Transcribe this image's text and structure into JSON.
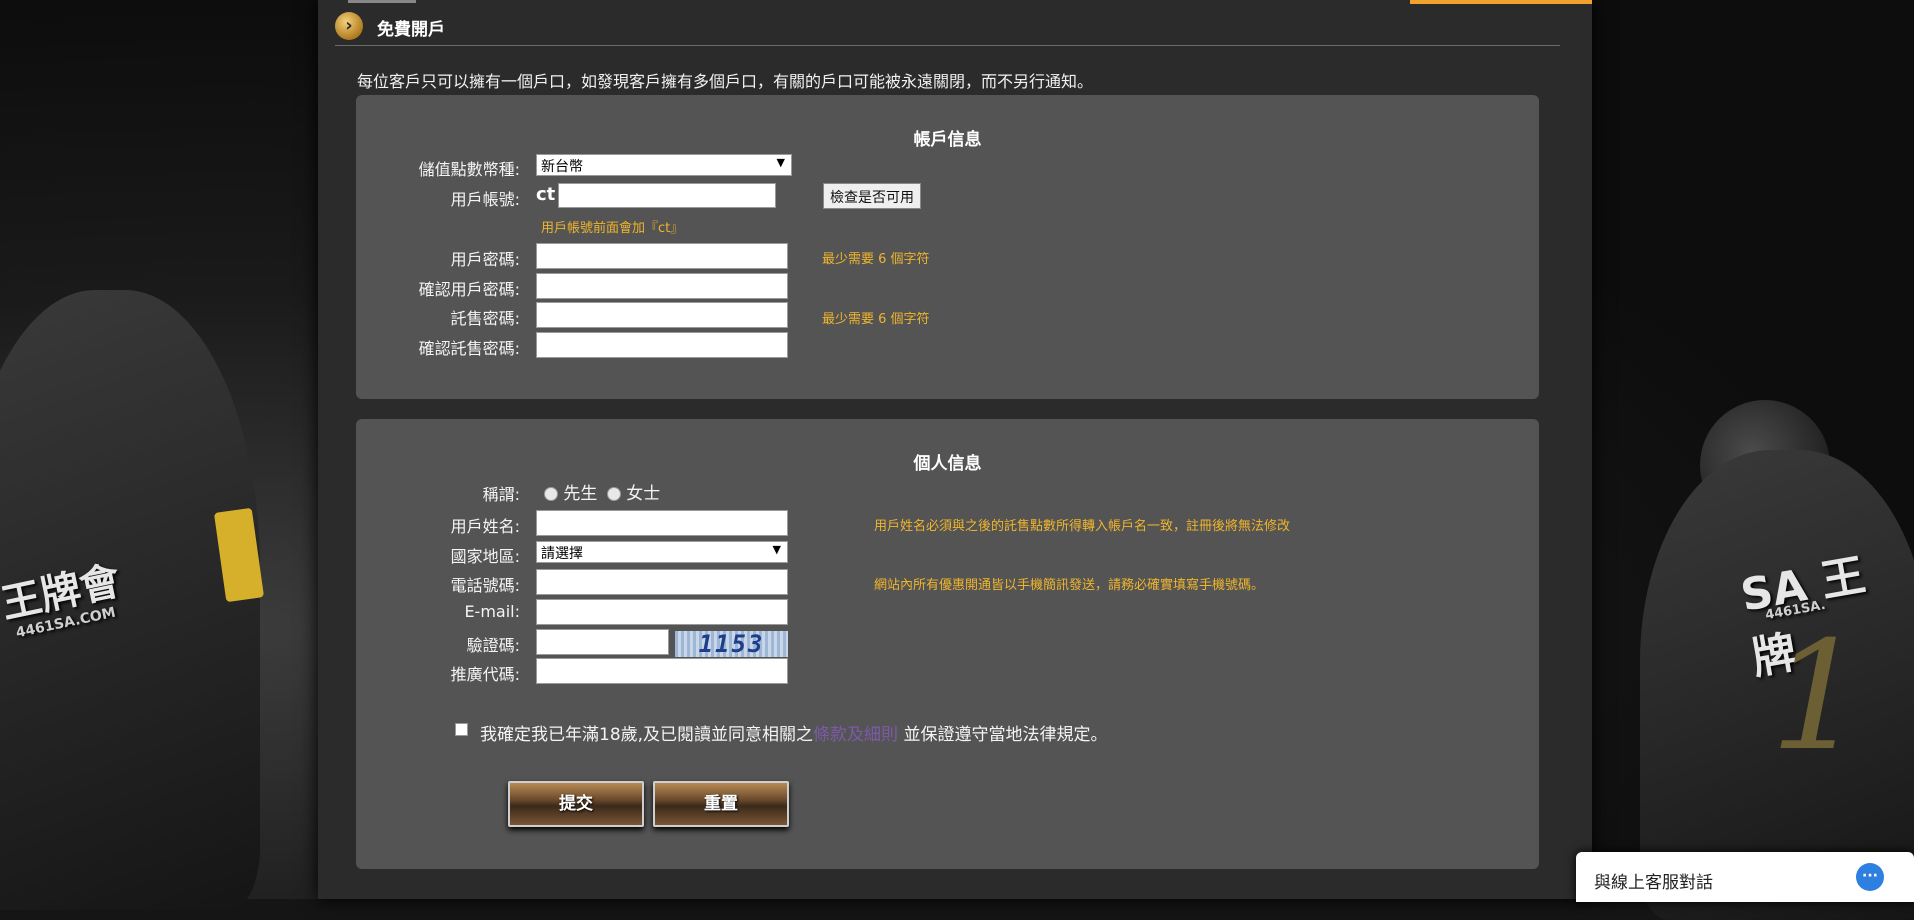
{
  "header": {
    "title": "免費開戶",
    "notice": "每位客戶只可以擁有一個戶口，如發現客戶擁有多個戶口，有關的戶口可能被永遠關閉，而不另行通知。"
  },
  "account": {
    "title": "帳戶信息",
    "currency_label": "儲值點數幣種:",
    "currency_value": "新台幣",
    "username_label": "用戶帳號:",
    "username_prefix": "ct",
    "username_value": "",
    "check_button": "檢查是否可用",
    "username_hint": "用戶帳號前面會加『ct』",
    "password_label": "用戶密碼:",
    "password_hint": "最少需要 6 個字符",
    "confirm_password_label": "確認用戶密碼:",
    "trade_password_label": "託售密碼:",
    "trade_password_hint": "最少需要 6 個字符",
    "confirm_trade_password_label": "確認託售密碼:"
  },
  "personal": {
    "title": "個人信息",
    "salutation_label": "稱謂:",
    "salutation_mr": "先生",
    "salutation_ms": "女士",
    "name_label": "用戶姓名:",
    "name_hint": "用戶姓名必須與之後的託售點數所得轉入帳戶名一致，註冊後將無法修改",
    "country_label": "國家地區:",
    "country_value": "請選擇",
    "phone_label": "電話號碼:",
    "phone_hint": "網站內所有優惠開通皆以手機簡訊發送，請務必確實填寫手機號碼。",
    "email_label": "E-mail:",
    "captcha_label": "驗證碼:",
    "captcha_text": "1153",
    "promo_label": "推廣代碼:",
    "agree_prefix": "我確定我已年滿18歲,及已閱讀並同意相關之",
    "agree_link": "條款及細則",
    "agree_suffix": " 並保證遵守當地法律規定。",
    "submit_button": "提交",
    "reset_button": "重置"
  },
  "branding": {
    "left_logo": "王牌會",
    "left_logo_sub": "4461SA.COM",
    "right_logo": "SA 王牌",
    "right_logo_sub": "4461SA.",
    "right_number": "1"
  },
  "chat": {
    "label": "與線上客服對話",
    "icon": "chat-bubble-icon"
  },
  "colors": {
    "hint": "#f0b52c",
    "panel": "#545454",
    "accent": "#f0a22c",
    "link": "#7c5aa8"
  }
}
